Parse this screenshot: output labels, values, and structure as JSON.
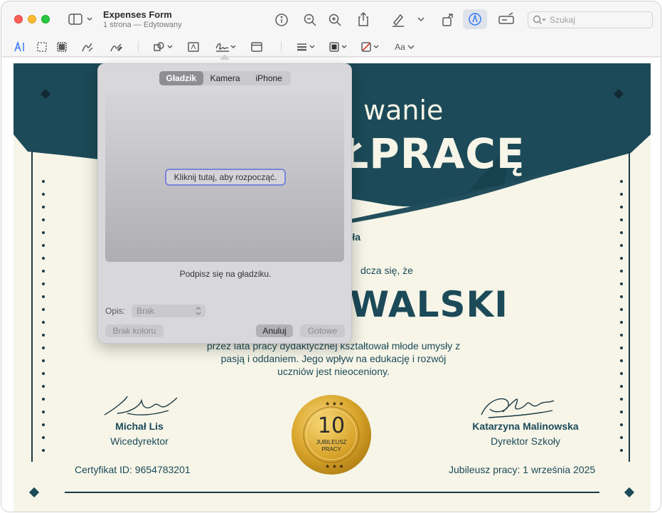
{
  "window": {
    "title": "Expenses Form",
    "subtitle": "1 strona — Edytowany"
  },
  "toolbar": {
    "search_placeholder": "Szukaj",
    "text_style_label": "Aa"
  },
  "certificate": {
    "heading_line1": "wanie",
    "heading_line2": "ŁPRACĘ",
    "school": "koła",
    "confirms": "dcza się, że",
    "name": "WALSKI",
    "body_line1": "przez lata pracy dydaktycznej kształtował młode umysły z",
    "body_line2": "pasją i oddaniem. Jego wpływ na edukację i rozwój",
    "body_line3": "uczniów jest nieoceniony.",
    "signer_left_name": "Michał Lis",
    "signer_left_role": "Wicedyrektor",
    "signer_right_name": "Katarzyna Malinowska",
    "signer_right_role": "Dyrektor Szkoły",
    "medal_number": "10",
    "medal_text1": "JUBILEUSZ",
    "medal_text2": "PRACY",
    "certificate_id": "Certyfikat ID: 9654783201",
    "jubilee_date": "Jubileusz pracy: 1 września 2025",
    "colors": {
      "header": "#1c4a58",
      "background": "#f6f5e8",
      "text": "#1c4a58"
    }
  },
  "signature_popover": {
    "tabs": [
      {
        "label": "Gładzik",
        "active": true
      },
      {
        "label": "Kamera",
        "active": false
      },
      {
        "label": "iPhone",
        "active": false
      }
    ],
    "click_to_start": "Kliknij tutaj, aby rozpocząć.",
    "hint": "Podpisz się na gładziku.",
    "description_label": "Opis:",
    "description_value": "Brak",
    "no_color_label": "Brak koloru",
    "cancel_label": "Anuluj",
    "done_label": "Gotowe"
  },
  "icons": {
    "accent_color": "#3478f6"
  }
}
